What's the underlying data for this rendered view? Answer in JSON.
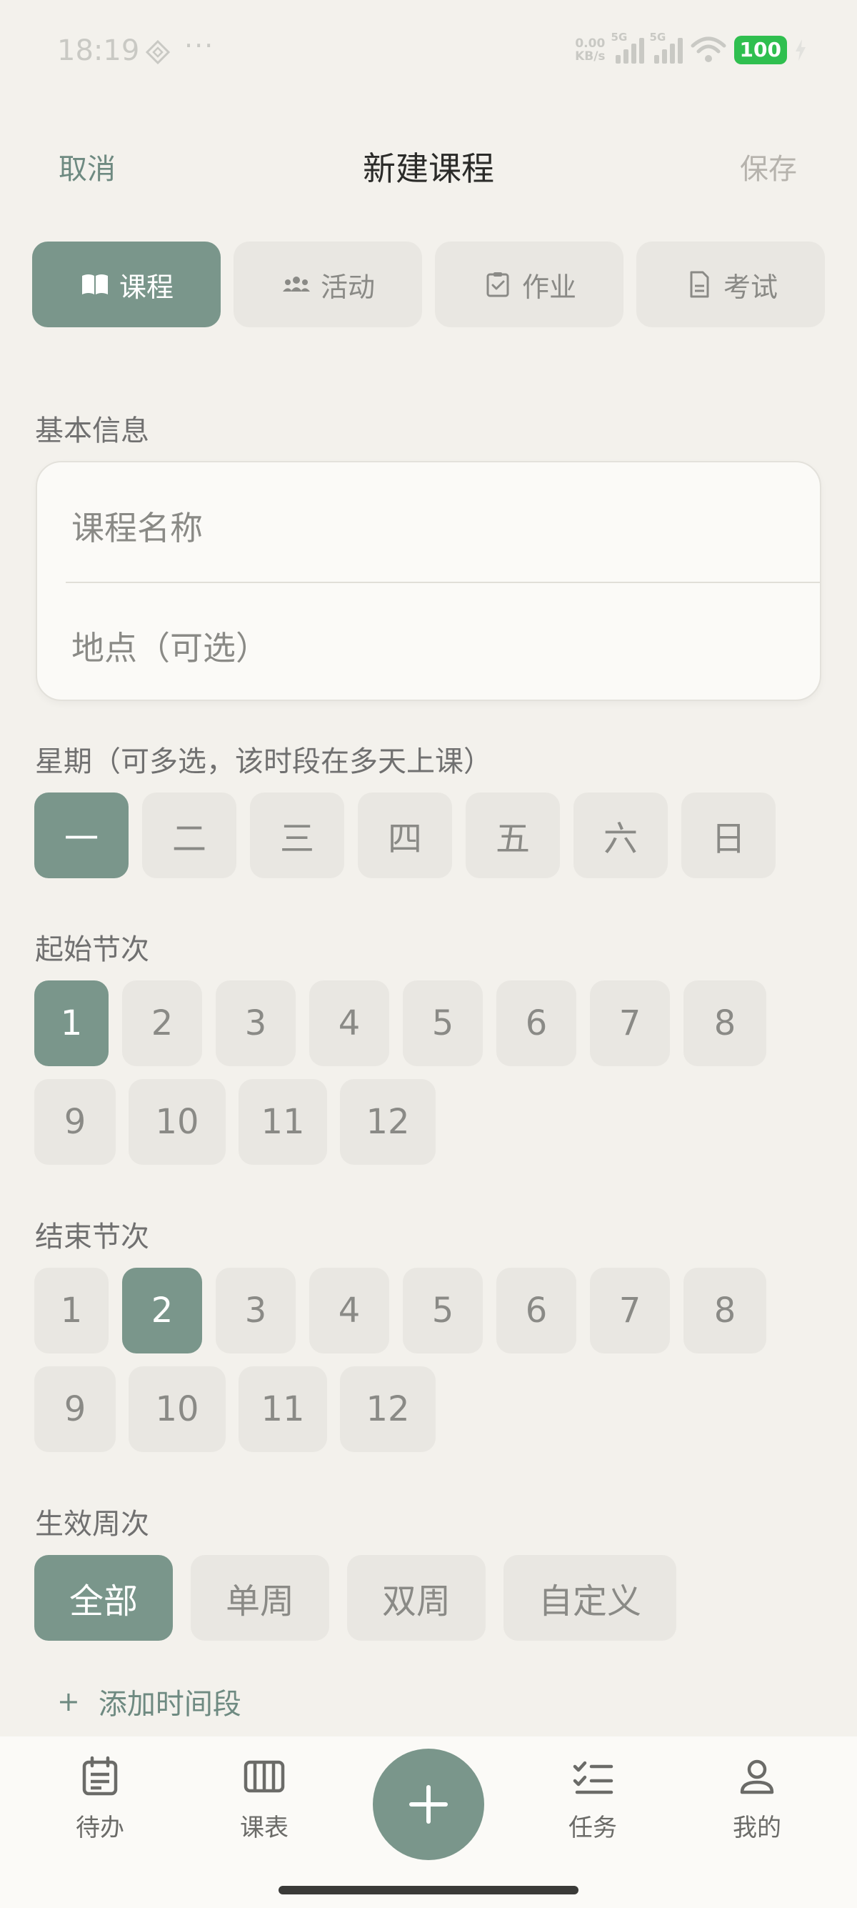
{
  "status_bar": {
    "time": "18:19",
    "more": "···",
    "net_speed_top": "0.00",
    "net_speed_bottom": "KB/s",
    "sim1_label": "5G",
    "sim2_label": "5G",
    "battery": "100"
  },
  "header": {
    "cancel_label": "取消",
    "title": "新建课程",
    "save_label": "保存"
  },
  "type_tabs": [
    {
      "label": "课程",
      "icon": "book-open-icon",
      "active": true
    },
    {
      "label": "活动",
      "icon": "people-icon",
      "active": false
    },
    {
      "label": "作业",
      "icon": "clipboard-check-icon",
      "active": false
    },
    {
      "label": "考试",
      "icon": "document-icon",
      "active": false
    }
  ],
  "basic_info": {
    "section_label": "基本信息",
    "name_placeholder": "课程名称",
    "location_placeholder": "地点（可选）"
  },
  "weekday": {
    "section_label": "星期（可多选，该时段在多天上课）",
    "options": [
      "一",
      "二",
      "三",
      "四",
      "五",
      "六",
      "日"
    ],
    "selected": [
      "一"
    ]
  },
  "start_period": {
    "section_label": "起始节次",
    "options": [
      "1",
      "2",
      "3",
      "4",
      "5",
      "6",
      "7",
      "8",
      "9",
      "10",
      "11",
      "12"
    ],
    "selected": "1"
  },
  "end_period": {
    "section_label": "结束节次",
    "options": [
      "1",
      "2",
      "3",
      "4",
      "5",
      "6",
      "7",
      "8",
      "9",
      "10",
      "11",
      "12"
    ],
    "selected": "2"
  },
  "weeks": {
    "section_label": "生效周次",
    "options": [
      "全部",
      "单周",
      "双周",
      "自定义"
    ],
    "selected": "全部"
  },
  "add_slot": {
    "plus": "+",
    "label": "添加时间段"
  },
  "bottom_nav": {
    "todo_label": "待办",
    "schedule_label": "课表",
    "tasks_label": "任务",
    "mine_label": "我的"
  },
  "colors": {
    "accent": "#7a968b",
    "background": "#f3f1ec",
    "chip_bg": "#e9e7e2",
    "card_bg": "#fbfaf7",
    "link_text": "#6e8a81"
  }
}
